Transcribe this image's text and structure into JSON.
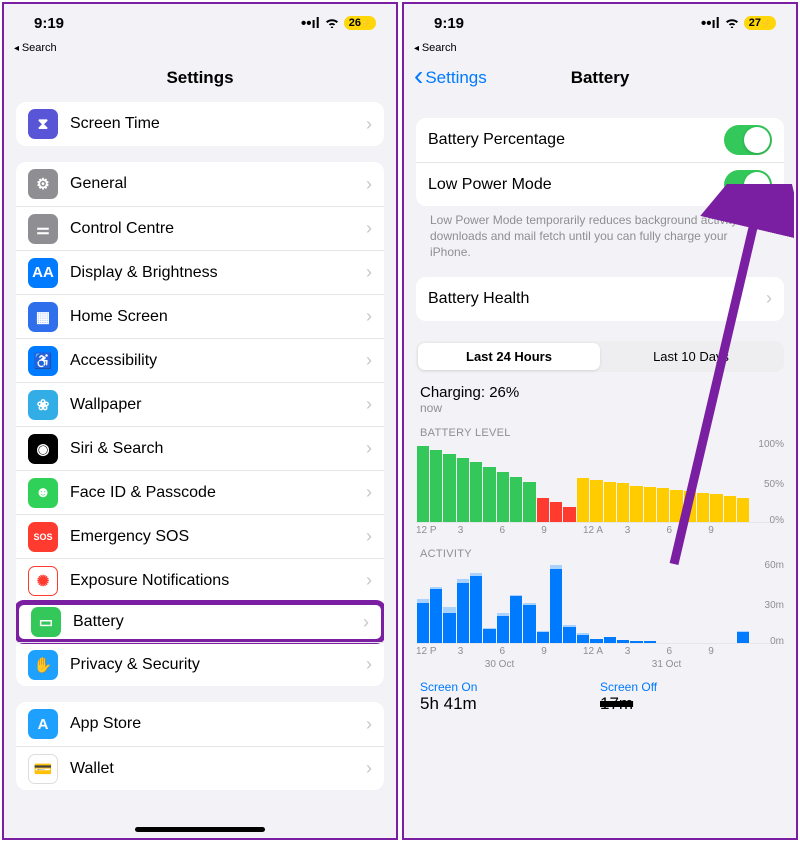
{
  "left": {
    "status": {
      "time": "9:19",
      "battery": "26"
    },
    "subnav": "Search",
    "title": "Settings",
    "group0": [
      {
        "label": "Screen Time",
        "icon": "hourglass-icon",
        "color": "c-purple",
        "glyph": "⧗"
      }
    ],
    "group1": [
      {
        "label": "General",
        "icon": "gear-icon",
        "color": "c-gray",
        "glyph": "⚙"
      },
      {
        "label": "Control Centre",
        "icon": "sliders-icon",
        "color": "c-gray",
        "glyph": "⚌"
      },
      {
        "label": "Display & Brightness",
        "icon": "display-icon",
        "color": "c-blue",
        "glyph": "AA"
      },
      {
        "label": "Home Screen",
        "icon": "grid-icon",
        "color": "c-indigo",
        "glyph": "▦"
      },
      {
        "label": "Accessibility",
        "icon": "accessibility-icon",
        "color": "c-blue",
        "glyph": "♿"
      },
      {
        "label": "Wallpaper",
        "icon": "flower-icon",
        "color": "c-cyan",
        "glyph": "❀"
      },
      {
        "label": "Siri & Search",
        "icon": "siri-icon",
        "color": "c-black",
        "glyph": "◉"
      },
      {
        "label": "Face ID & Passcode",
        "icon": "face-icon",
        "color": "c-green2",
        "glyph": "☻"
      },
      {
        "label": "Emergency SOS",
        "icon": "sos-icon",
        "color": "c-red",
        "glyph": "SOS"
      },
      {
        "label": "Exposure Notifications",
        "icon": "exposure-icon",
        "color": "c-redring",
        "glyph": "✺"
      },
      {
        "label": "Battery",
        "icon": "battery-icon",
        "color": "c-green",
        "glyph": "▭",
        "highlight": true
      },
      {
        "label": "Privacy & Security",
        "icon": "hand-icon",
        "color": "c-lightblue",
        "glyph": "✋"
      }
    ],
    "group2": [
      {
        "label": "App Store",
        "icon": "appstore-icon",
        "color": "c-lightblue",
        "glyph": "A"
      },
      {
        "label": "Wallet",
        "icon": "wallet-icon",
        "color": "c-wallet",
        "glyph": "💳"
      }
    ]
  },
  "right": {
    "status": {
      "time": "9:19",
      "battery": "27"
    },
    "subnav": "Search",
    "back": "Settings",
    "title": "Battery",
    "toggles": [
      {
        "label": "Battery Percentage",
        "on": true
      },
      {
        "label": "Low Power Mode",
        "on": true
      }
    ],
    "lpm_note": "Low Power Mode temporarily reduces background activity like downloads and mail fetch until you can fully charge your iPhone.",
    "health_label": "Battery Health",
    "segments": {
      "a": "Last 24 Hours",
      "b": "Last 10 Days"
    },
    "charging": {
      "line": "Charging: 26%",
      "sub": "now"
    },
    "battery_level_title": "BATTERY LEVEL",
    "activity_title": "ACTIVITY",
    "y_labels_level": [
      "100%",
      "50%",
      "0%"
    ],
    "y_labels_activity": [
      "60m",
      "30m",
      "0m"
    ],
    "x_labels": [
      "12 P",
      "3",
      "6",
      "9",
      "12 A",
      "3",
      "6",
      "9"
    ],
    "date_a": "30 Oct",
    "date_b": "31 Oct",
    "usage": {
      "screen_on_label": "Screen On",
      "screen_on_val": "5h 41m",
      "screen_off_label": "Screen Off",
      "screen_off_val": "17m"
    }
  },
  "chart_data": [
    {
      "type": "bar",
      "title": "BATTERY LEVEL",
      "ylabel": "%",
      "ylim": [
        0,
        100
      ],
      "x": [
        "12P",
        "",
        "",
        "3",
        "",
        "",
        "6",
        "",
        "",
        "9",
        "",
        "",
        "12A",
        "",
        "",
        "3",
        "",
        "",
        "6",
        "",
        "",
        "9",
        "",
        "",
        ""
      ],
      "series": [
        {
          "name": "normal",
          "color": "#34c759",
          "values": [
            95,
            90,
            85,
            80,
            74,
            68,
            62,
            56,
            50,
            0,
            0,
            0,
            0,
            0,
            0,
            0,
            0,
            0,
            0,
            0,
            0,
            0,
            0,
            0,
            0
          ]
        },
        {
          "name": "low",
          "color": "#ff3b30",
          "values": [
            0,
            0,
            0,
            0,
            0,
            0,
            0,
            0,
            0,
            30,
            24,
            18,
            0,
            0,
            0,
            0,
            0,
            0,
            0,
            0,
            0,
            0,
            0,
            0,
            0
          ]
        },
        {
          "name": "lpm",
          "color": "#ffcc00",
          "values": [
            0,
            0,
            0,
            0,
            0,
            0,
            0,
            0,
            0,
            0,
            0,
            0,
            55,
            52,
            50,
            48,
            45,
            43,
            42,
            40,
            38,
            36,
            34,
            32,
            30
          ]
        }
      ]
    },
    {
      "type": "bar",
      "title": "ACTIVITY",
      "ylabel": "minutes",
      "ylim": [
        0,
        60
      ],
      "x": [
        "12P",
        "",
        "",
        "3",
        "",
        "",
        "6",
        "",
        "",
        "9",
        "",
        "",
        "12A",
        "",
        "",
        "3",
        "",
        "",
        "6",
        "",
        "",
        "9",
        "",
        "",
        ""
      ],
      "series": [
        {
          "name": "screen_on",
          "color": "#007aff",
          "values": [
            30,
            40,
            22,
            45,
            50,
            10,
            20,
            35,
            28,
            8,
            55,
            12,
            6,
            3,
            4,
            2,
            1,
            1,
            0,
            0,
            0,
            0,
            0,
            0,
            8
          ]
        },
        {
          "name": "screen_off",
          "color": "#a9d2ff",
          "values": [
            3,
            2,
            5,
            3,
            2,
            1,
            2,
            1,
            2,
            1,
            3,
            1,
            1,
            0,
            0,
            0,
            0,
            0,
            0,
            0,
            0,
            0,
            0,
            0,
            1
          ]
        }
      ]
    }
  ]
}
